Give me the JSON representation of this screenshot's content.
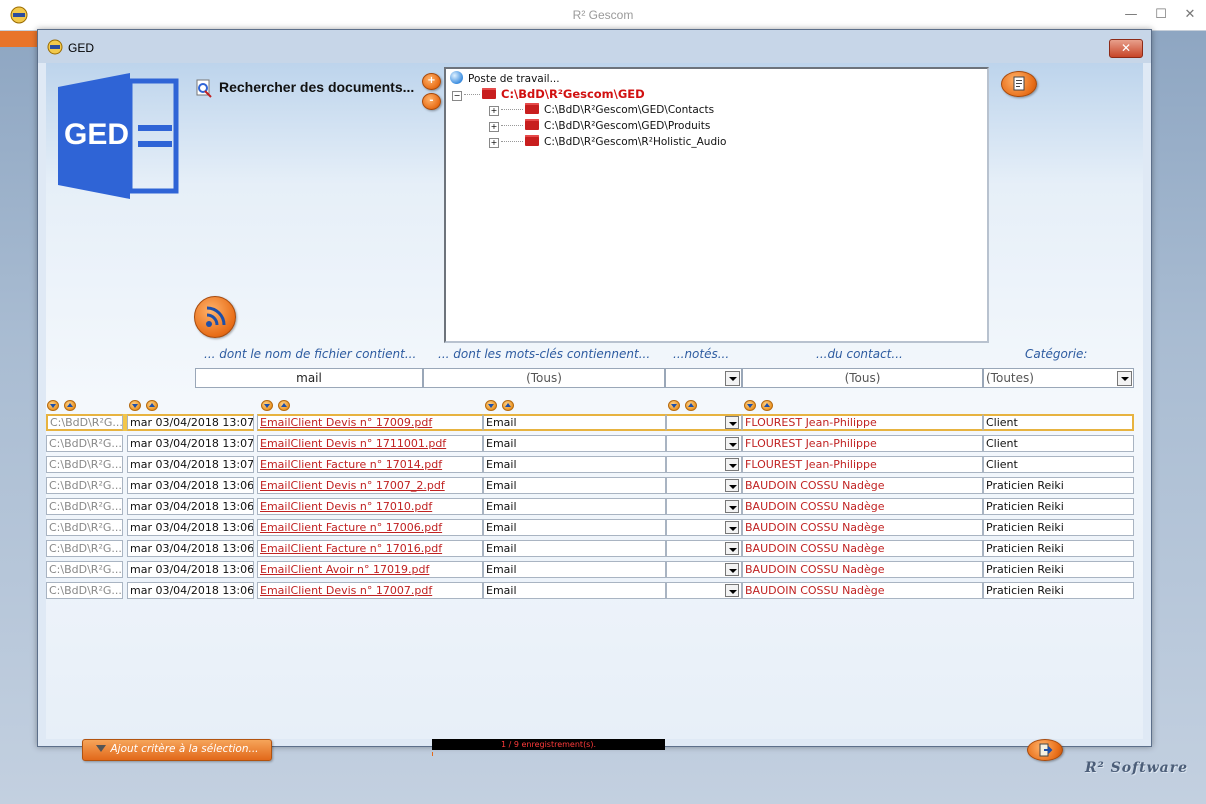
{
  "app": {
    "title": "R² Gescom",
    "brand": "R² Software",
    "controls": {
      "minimize": "—",
      "maximize": "☐",
      "close": "✕"
    }
  },
  "dialog": {
    "title": "GED",
    "close_label": "✕"
  },
  "search": {
    "title": "Rechercher des documents...",
    "plus_label": "+",
    "minus_label": "-"
  },
  "tree": {
    "root": "Poste de travail...",
    "ged_folder": "C:\\BdD\\R²Gescom\\GED",
    "children": [
      "C:\\BdD\\R²Gescom\\GED\\Contacts",
      "C:\\BdD\\R²Gescom\\GED\\Produits",
      "C:\\BdD\\R²Gescom\\R²Holistic_Audio"
    ],
    "expanded_symbol": "⊟",
    "collapsed_symbol": "+"
  },
  "filters": {
    "labels": {
      "filename": "... dont le nom de fichier contient...",
      "keywords": "... dont les mots-clés contiennent...",
      "rated": "...notés...",
      "contact": "...du contact...",
      "category": "Catégorie:"
    },
    "values": {
      "filename": "mail",
      "keywords": "(Tous)",
      "rated": "",
      "contact": "(Tous)",
      "category": "(Toutes)"
    }
  },
  "rows": [
    {
      "path": "C:\\BdD\\R²G...\\",
      "date": "mar 03/04/2018 13:07",
      "file": "EmailClient Devis n° 17009.pdf",
      "keywords": "Email",
      "contact": "FLOUREST Jean-Philippe",
      "category": "Client"
    },
    {
      "path": "C:\\BdD\\R²G...\\",
      "date": "mar 03/04/2018 13:07",
      "file": "EmailClient Devis n° 1711001.pdf",
      "keywords": "Email",
      "contact": "FLOUREST Jean-Philippe",
      "category": "Client"
    },
    {
      "path": "C:\\BdD\\R²G...\\",
      "date": "mar 03/04/2018 13:07",
      "file": "EmailClient Facture n° 17014.pdf",
      "keywords": "Email",
      "contact": "FLOUREST Jean-Philippe",
      "category": "Client"
    },
    {
      "path": "C:\\BdD\\R²G...\\",
      "date": "mar 03/04/2018 13:06",
      "file": "EmailClient Devis n° 17007_2.pdf",
      "keywords": "Email",
      "contact": "BAUDOIN COSSU Nadège",
      "category": "Praticien Reiki"
    },
    {
      "path": "C:\\BdD\\R²G...\\",
      "date": "mar 03/04/2018 13:06",
      "file": "EmailClient Devis n° 17010.pdf",
      "keywords": "Email",
      "contact": "BAUDOIN COSSU Nadège",
      "category": "Praticien Reiki"
    },
    {
      "path": "C:\\BdD\\R²G...\\",
      "date": "mar 03/04/2018 13:06",
      "file": "EmailClient Facture n° 17006.pdf",
      "keywords": "Email",
      "contact": "BAUDOIN COSSU Nadège",
      "category": "Praticien Reiki"
    },
    {
      "path": "C:\\BdD\\R²G...\\",
      "date": "mar 03/04/2018 13:06",
      "file": "EmailClient Facture n° 17016.pdf",
      "keywords": "Email",
      "contact": "BAUDOIN COSSU Nadège",
      "category": "Praticien Reiki"
    },
    {
      "path": "C:\\BdD\\R²G...\\",
      "date": "mar 03/04/2018 13:06",
      "file": "EmailClient Avoir n° 17019.pdf",
      "keywords": "Email",
      "contact": "BAUDOIN COSSU Nadège",
      "category": "Praticien Reiki"
    },
    {
      "path": "C:\\BdD\\R²G...\\",
      "date": "mar 03/04/2018 13:06",
      "file": "EmailClient Devis n° 17007.pdf",
      "keywords": "Email",
      "contact": "BAUDOIN COSSU Nadège",
      "category": "Praticien Reiki"
    }
  ],
  "footer": {
    "add_criteria": "Ajout critère à la sélection...",
    "record_count": "1 / 9 enregistrement(s)."
  },
  "logo": {
    "text": "GED",
    "color": "#2f64d6"
  },
  "colors": {
    "accent": "#e8742a",
    "link_red": "#c02222",
    "selection": "#e7b340"
  }
}
